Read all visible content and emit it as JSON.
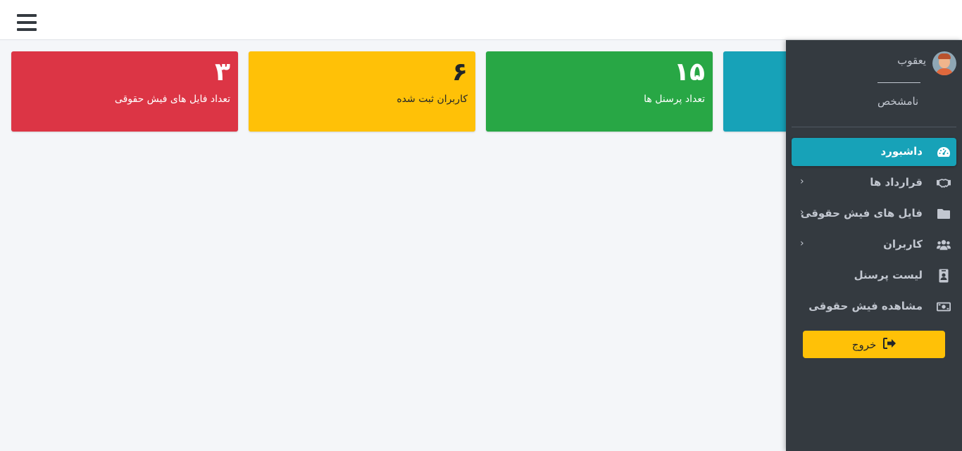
{
  "topbar": {
    "menu_icon": "hamburger-icon"
  },
  "stats": [
    {
      "value": "۳",
      "label": "تعداد فایل های فیش حقوقی",
      "color": "#dc3545",
      "text_color": "#ffffff"
    },
    {
      "value": "۶",
      "label": "کاربران ثبت شده",
      "color": "#ffc107",
      "text_color": "#212529"
    },
    {
      "value": "۱۵",
      "label": "تعداد پرسنل ها",
      "color": "#28a745",
      "text_color": "#ffffff"
    },
    {
      "value": "",
      "label": "",
      "color": "#17a2b8",
      "text_color": "#ffffff"
    }
  ],
  "sidebar": {
    "user_name": "یعقوب",
    "user_role": "نامشخص",
    "items": [
      {
        "label": "داشبورد",
        "icon": "dashboard-icon",
        "active": true,
        "has_submenu": false
      },
      {
        "label": "قرارداد ها",
        "icon": "handshake-icon",
        "active": false,
        "has_submenu": true
      },
      {
        "label": "فایل های فیش حقوقی",
        "icon": "folder-icon",
        "active": false,
        "has_submenu": true
      },
      {
        "label": "کاربران",
        "icon": "users-icon",
        "active": false,
        "has_submenu": true
      },
      {
        "label": "لیست پرسنل",
        "icon": "id-badge-icon",
        "active": false,
        "has_submenu": false
      },
      {
        "label": "مشاهده فیش حقوقی",
        "icon": "money-bill-icon",
        "active": false,
        "has_submenu": false
      }
    ],
    "logout_label": "خروج",
    "logout_icon": "sign-out-icon",
    "accent": "#17a2b8"
  }
}
